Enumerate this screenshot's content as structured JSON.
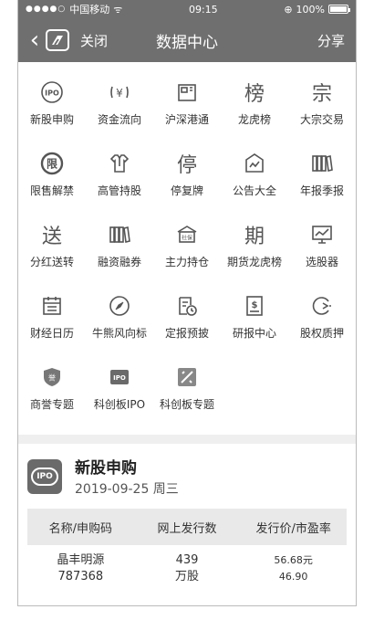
{
  "status_bar": {
    "carrier": "中国移动",
    "time": "09:15",
    "battery": "100%"
  },
  "navbar": {
    "close": "关闭",
    "title": "数据中心",
    "share": "分享"
  },
  "grid": [
    {
      "label": "新股申购",
      "icon": "ipo-icon",
      "glyph": "IPO"
    },
    {
      "label": "资金流向",
      "icon": "yuan-icon",
      "glyph": "¥"
    },
    {
      "label": "沪深港通",
      "icon": "connect-icon",
      "glyph": "沪"
    },
    {
      "label": "龙虎榜",
      "icon": "bang-icon",
      "glyph": "榜"
    },
    {
      "label": "大宗交易",
      "icon": "zong-icon",
      "glyph": "宗"
    },
    {
      "label": "限售解禁",
      "icon": "xian-icon",
      "glyph": "限"
    },
    {
      "label": "高管持股",
      "icon": "shirt-icon",
      "glyph": ""
    },
    {
      "label": "停复牌",
      "icon": "ting-icon",
      "glyph": "停"
    },
    {
      "label": "公告大全",
      "icon": "announcement-icon",
      "glyph": ""
    },
    {
      "label": "年报季报",
      "icon": "books-icon",
      "glyph": ""
    },
    {
      "label": "分红送转",
      "icon": "song-icon",
      "glyph": "送"
    },
    {
      "label": "融资融券",
      "icon": "books-icon",
      "glyph": ""
    },
    {
      "label": "主力持仓",
      "icon": "shebao-icon",
      "glyph": "社保"
    },
    {
      "label": "期货龙虎榜",
      "icon": "qi-icon",
      "glyph": "期"
    },
    {
      "label": "选股器",
      "icon": "monitor-chart-icon",
      "glyph": ""
    },
    {
      "label": "财经日历",
      "icon": "calendar-icon",
      "glyph": ""
    },
    {
      "label": "牛熊风向标",
      "icon": "compass-icon",
      "glyph": ""
    },
    {
      "label": "定报预披",
      "icon": "report-clock-icon",
      "glyph": ""
    },
    {
      "label": "研报中心",
      "icon": "research-icon",
      "glyph": ""
    },
    {
      "label": "股权质押",
      "icon": "pledge-icon",
      "glyph": ""
    },
    {
      "label": "商誉专题",
      "icon": "shield-icon",
      "glyph": "誉"
    },
    {
      "label": "科创板IPO",
      "icon": "kcb-ipo-icon",
      "glyph": "IPO"
    },
    {
      "label": "科创板专题",
      "icon": "kcb-topic-icon",
      "glyph": ""
    }
  ],
  "ipo": {
    "title": "新股申购",
    "date": "2019-09-25 周三",
    "badge": "IPO",
    "columns": [
      "名称/申购码",
      "网上发行数",
      "发行价/市盈率"
    ],
    "rows": [
      {
        "name": "晶丰明源",
        "code": "787368",
        "issue_num": "439",
        "issue_unit": "万股",
        "price": "56.68元",
        "pe": "46.90"
      }
    ]
  }
}
